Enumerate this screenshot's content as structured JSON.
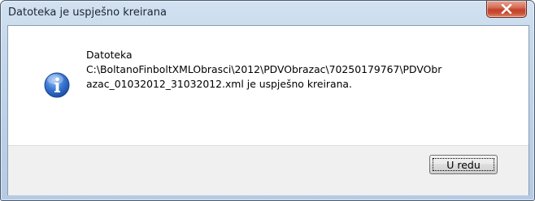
{
  "window": {
    "title": "Datoteka je uspješno kreirana",
    "close_label": "X"
  },
  "message": {
    "line1": "Datoteka",
    "line2": "C:\\BoltanoFinboltXMLObrasci\\2012\\PDVObrazac\\70250179767\\PDVObr",
    "line3": "azac_01032012_31032012.xml je uspješno kreirana."
  },
  "icon": {
    "name": "info-icon",
    "color": "#2a64c5"
  },
  "buttons": {
    "ok_label": "U redu"
  }
}
